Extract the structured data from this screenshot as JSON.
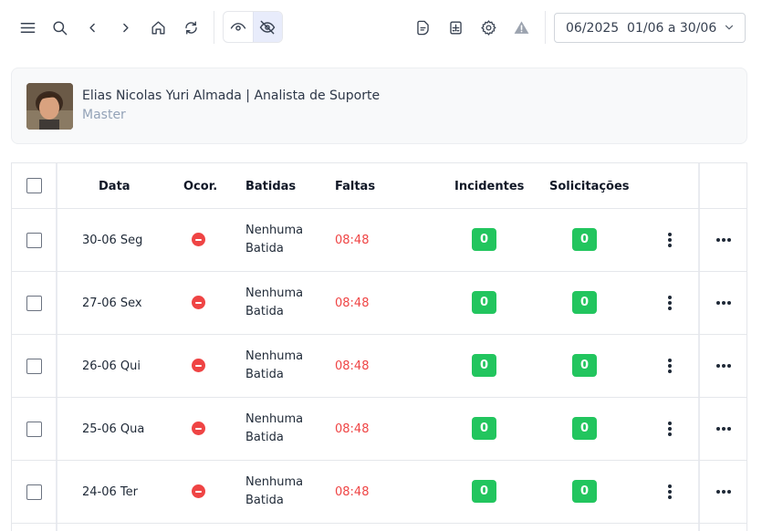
{
  "toolbar": {
    "icons": [
      "menu-icon",
      "search-icon",
      "chevron-left-icon",
      "chevron-right-icon",
      "home-icon",
      "refresh-icon",
      "eye-icon",
      "eye-off-icon",
      "document-icon",
      "calculator-icon",
      "gear-icon",
      "warning-icon"
    ],
    "period_label": "06/2025  01/06 a 30/06"
  },
  "profile": {
    "name": "Elias Nicolas Yuri Almada | Analista de Suporte",
    "role": "Master"
  },
  "table": {
    "headers": {
      "date": "Data",
      "occurrence": "Ocor.",
      "punches": "Batidas",
      "absences": "Faltas",
      "incidents": "Incidentes",
      "requests": "Solicitações"
    },
    "rows": [
      {
        "date": "30-06 Seg",
        "punches_line1": "Nenhuma",
        "punches_line2": "Batida",
        "absence": "08:48",
        "incidents": "0",
        "requests": "0"
      },
      {
        "date": "27-06 Sex",
        "punches_line1": "Nenhuma",
        "punches_line2": "Batida",
        "absence": "08:48",
        "incidents": "0",
        "requests": "0"
      },
      {
        "date": "26-06 Qui",
        "punches_line1": "Nenhuma",
        "punches_line2": "Batida",
        "absence": "08:48",
        "incidents": "0",
        "requests": "0"
      },
      {
        "date": "25-06 Qua",
        "punches_line1": "Nenhuma",
        "punches_line2": "Batida",
        "absence": "08:48",
        "incidents": "0",
        "requests": "0"
      },
      {
        "date": "24-06 Ter",
        "punches_line1": "Nenhuma",
        "punches_line2": "Batida",
        "absence": "08:48",
        "incidents": "0",
        "requests": "0"
      }
    ]
  },
  "colors": {
    "absence_text": "#ef4444",
    "badge_green": "#22c55e",
    "occurrence_red": "#ef4444",
    "active_toggle": "#e8ecfb"
  }
}
